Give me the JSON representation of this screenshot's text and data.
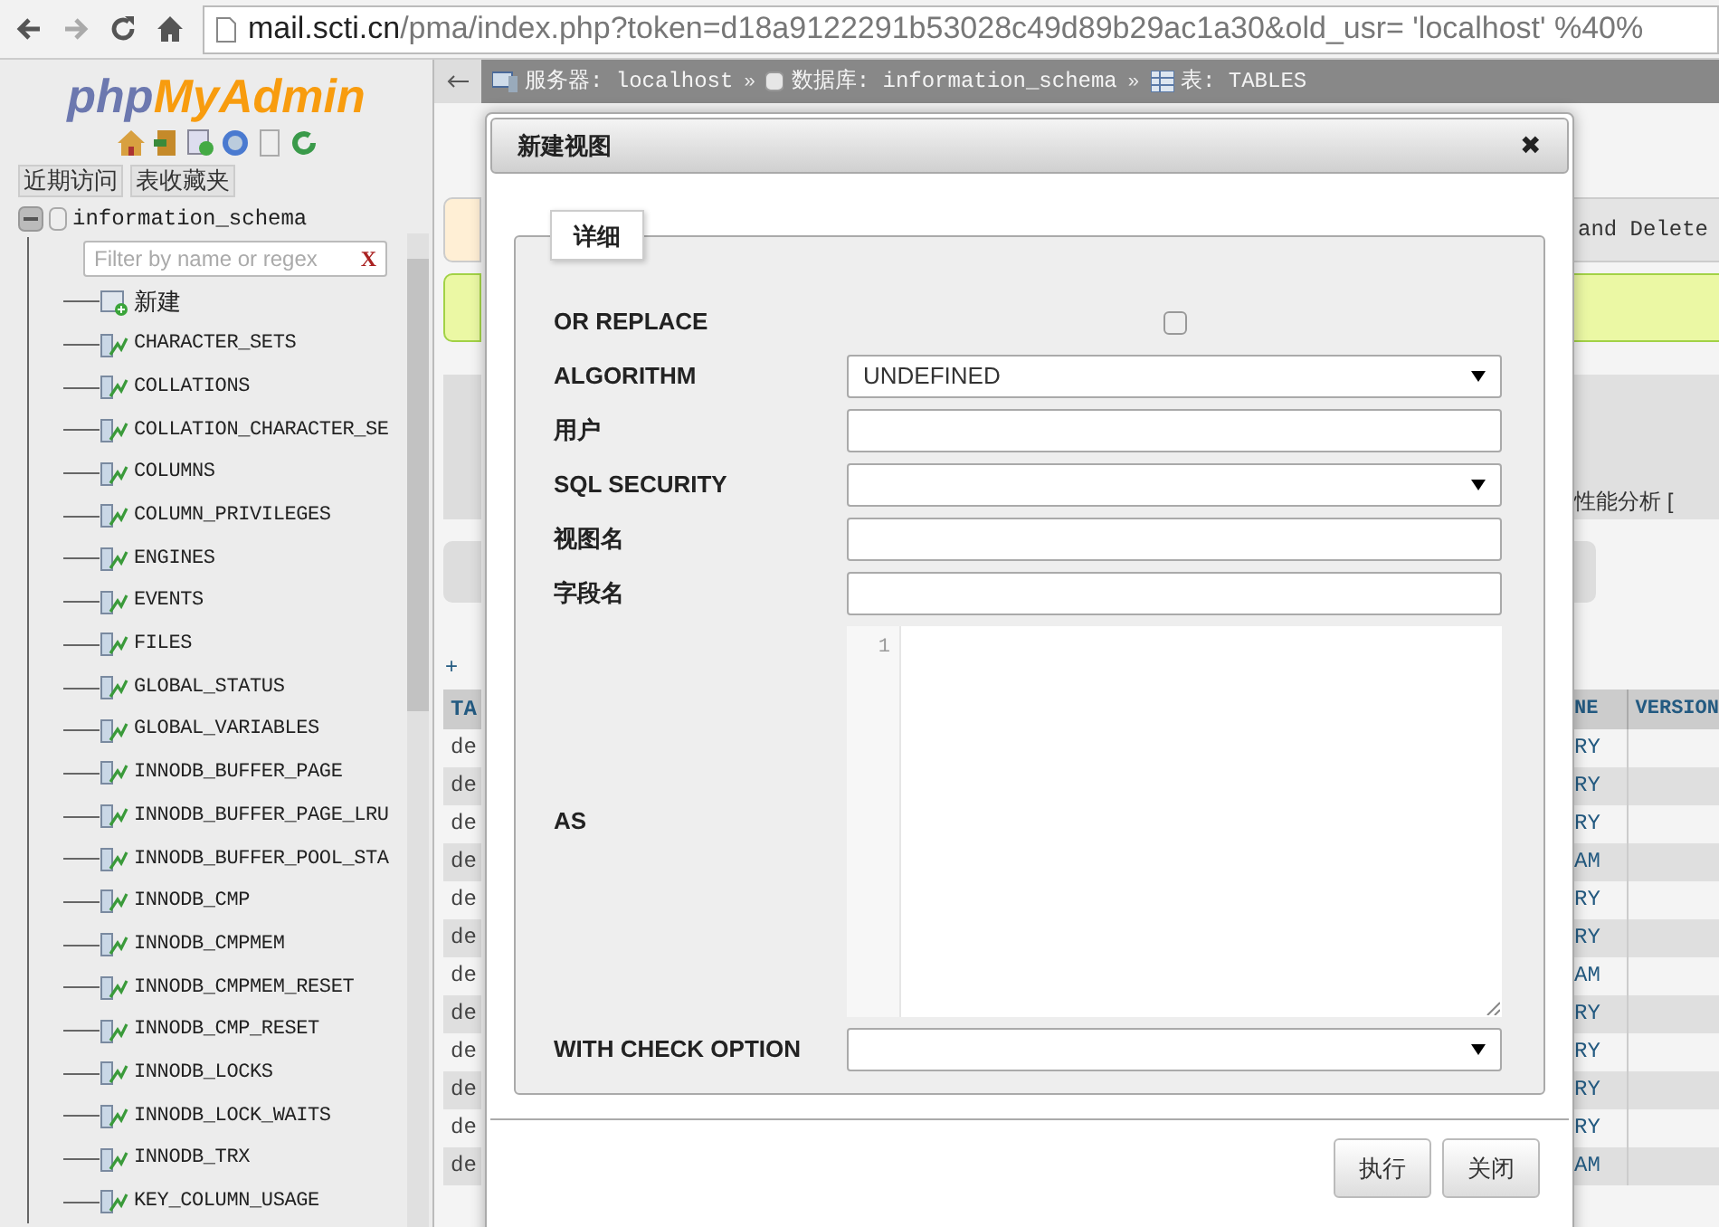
{
  "browser": {
    "url_host": "mail.scti.cn",
    "url_rest": "/pma/index.php?token=d18a9122291b53028c49d89b29ac1a30&old_usr=  'localhost'  %40%"
  },
  "sidebar": {
    "logo_left": "php",
    "logo_right": "MyAdmin",
    "tabs": [
      {
        "label": "近期访问"
      },
      {
        "label": "表收藏夹"
      }
    ],
    "filter": {
      "placeholder": "Filter by name or regex",
      "clear": "X"
    },
    "tree": [
      {
        "label": "information_schema",
        "expanded": true,
        "children": [
          {
            "label": "新建",
            "kind": "new"
          },
          {
            "label": "CHARACTER_SETS",
            "kind": "view"
          },
          {
            "label": "COLLATIONS",
            "kind": "view"
          },
          {
            "label": "COLLATION_CHARACTER_SE",
            "kind": "view"
          },
          {
            "label": "COLUMNS",
            "kind": "view"
          },
          {
            "label": "COLUMN_PRIVILEGES",
            "kind": "view"
          },
          {
            "label": "ENGINES",
            "kind": "view"
          },
          {
            "label": "EVENTS",
            "kind": "view"
          },
          {
            "label": "FILES",
            "kind": "view"
          },
          {
            "label": "GLOBAL_STATUS",
            "kind": "view"
          },
          {
            "label": "GLOBAL_VARIABLES",
            "kind": "view"
          },
          {
            "label": "INNODB_BUFFER_PAGE",
            "kind": "view"
          },
          {
            "label": "INNODB_BUFFER_PAGE_LRU",
            "kind": "view"
          },
          {
            "label": "INNODB_BUFFER_POOL_STA",
            "kind": "view"
          },
          {
            "label": "INNODB_CMP",
            "kind": "view"
          },
          {
            "label": "INNODB_CMPMEM",
            "kind": "view"
          },
          {
            "label": "INNODB_CMPMEM_RESET",
            "kind": "view"
          },
          {
            "label": "INNODB_CMP_RESET",
            "kind": "view"
          },
          {
            "label": "INNODB_LOCKS",
            "kind": "view"
          },
          {
            "label": "INNODB_LOCK_WAITS",
            "kind": "view"
          },
          {
            "label": "INNODB_TRX",
            "kind": "view"
          },
          {
            "label": "KEY_COLUMN_USAGE",
            "kind": "view"
          }
        ]
      }
    ]
  },
  "breadcrumb": [
    {
      "label": "服务器: localhost",
      "kind": "server"
    },
    {
      "label": "数据库: information_schema",
      "kind": "database"
    },
    {
      "label": "表: TABLES",
      "kind": "table"
    }
  ],
  "breadcrumb_separator": "»",
  "background": {
    "left_plus": "+",
    "left_header": "TA",
    "left_rows": [
      "de",
      "de",
      "de",
      "de",
      "de",
      "de",
      "de",
      "de",
      "de",
      "de",
      "de",
      "de"
    ],
    "right_notice": "and Delete",
    "right_profiling": "性能分析 [",
    "right_headers": [
      "NE",
      "VERSION"
    ],
    "right_rows": [
      "RY",
      "RY",
      "RY",
      "AM",
      "RY",
      "RY",
      "AM",
      "RY",
      "RY",
      "RY",
      "RY",
      "AM"
    ]
  },
  "dialog": {
    "title": "新建视图",
    "close": "✖",
    "legend": "详细",
    "fields": [
      {
        "label": "OR REPLACE",
        "kind": "checkbox",
        "checked": false
      },
      {
        "label": "ALGORITHM",
        "kind": "select",
        "value": "UNDEFINED"
      },
      {
        "label": "用户",
        "kind": "text"
      },
      {
        "label": "SQL SECURITY",
        "kind": "select"
      },
      {
        "label": "视图名",
        "kind": "text"
      },
      {
        "label": "字段名",
        "kind": "text"
      },
      {
        "label": "AS",
        "kind": "code",
        "line_number": "1"
      },
      {
        "label": "WITH CHECK OPTION",
        "kind": "select"
      }
    ],
    "buttons": [
      "执行",
      "关闭"
    ]
  }
}
